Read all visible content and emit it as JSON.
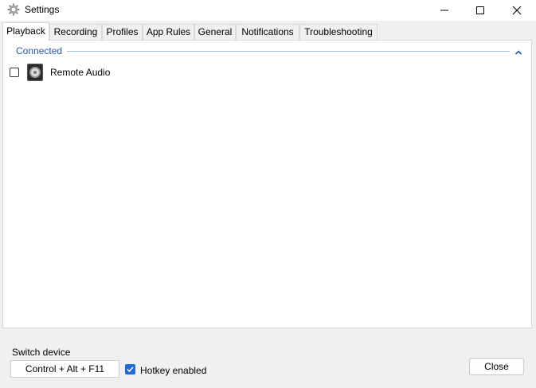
{
  "window": {
    "title": "Settings",
    "icon": "gear-icon",
    "controls": [
      "minimize-icon",
      "maximize-icon",
      "close-icon"
    ]
  },
  "tabs": [
    {
      "label": "Playback",
      "active": true
    },
    {
      "label": "Recording",
      "active": false
    },
    {
      "label": "Profiles",
      "active": false
    },
    {
      "label": "App Rules",
      "active": false
    },
    {
      "label": "General",
      "active": false
    },
    {
      "label": "Notifications",
      "active": false
    },
    {
      "label": "Troubleshooting",
      "active": false
    }
  ],
  "playback": {
    "group": {
      "header": "Connected",
      "collapse_icon": "chevron-up-icon",
      "devices": [
        {
          "label": "Remote Audio",
          "checked": false,
          "icon": "speaker-icon"
        }
      ]
    }
  },
  "footer": {
    "switch_label": "Switch device",
    "hotkey_value": "Control + Alt + F11",
    "hotkey_enabled_label": "Hotkey enabled",
    "hotkey_enabled": true,
    "close_label": "Close"
  },
  "colors": {
    "accent": "#1f6ad4",
    "group_header": "#2a5a9e"
  }
}
